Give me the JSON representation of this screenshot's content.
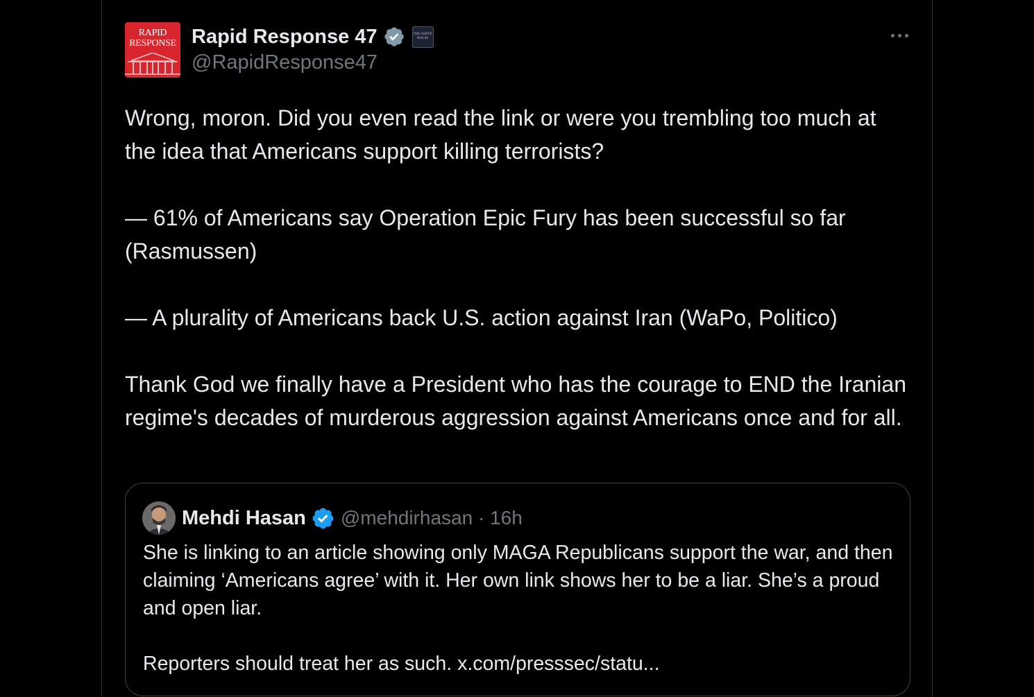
{
  "tweet": {
    "avatar_text": "RAPID RESPONSE",
    "display_name": "Rapid Response 47",
    "affiliation_badge_text": "THE WHITE HOUSE",
    "handle": "@RapidResponse47",
    "paragraphs": [
      "Wrong, moron. Did you even read the link or were you trembling too much at the idea that Americans support killing terrorists?",
      "— 61% of Americans say Operation Epic Fury has been successful so far (Rasmussen)",
      "— A plurality of Americans back U.S. action against Iran (WaPo, Politico)",
      "Thank God we finally have a President who has the courage to END the Iranian regime's decades of murderous aggression against Americans once and for all."
    ]
  },
  "quoted_tweet": {
    "display_name": "Mehdi Hasan",
    "handle_time": "@mehdirhasan · 16h",
    "paragraphs": [
      "She is linking to an article showing only MAGA Republicans support the war, and then claiming ‘Americans agree’ with it. Her own link shows her to be a liar. She’s a proud and open liar.",
      "Reporters should treat her as such. x.com/presssec/statu..."
    ]
  },
  "colors": {
    "background": "#000000",
    "text": "#e7e9ea",
    "muted": "#71767b",
    "verified_gray": "#829aab",
    "verified_blue": "#1d9bf0",
    "brand_red": "#d8262f"
  },
  "icons": {
    "more": "more-horizontal-icon",
    "verified_government": "verified-gray-badge-icon",
    "verified": "verified-blue-badge-icon"
  }
}
